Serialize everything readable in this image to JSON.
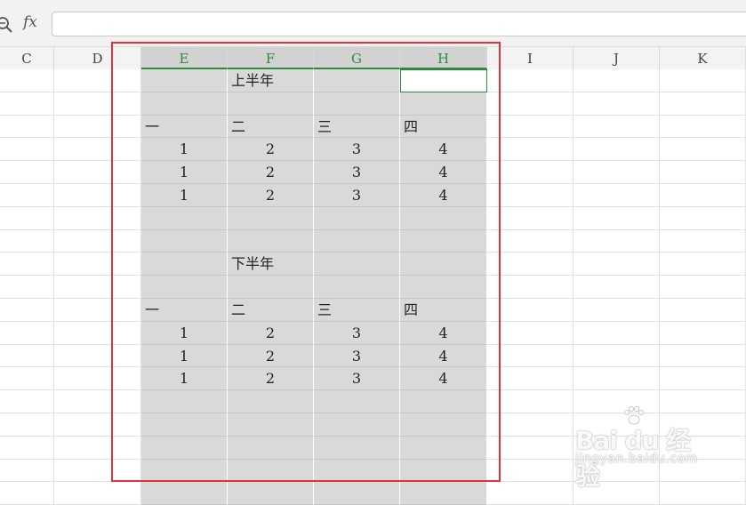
{
  "formula_bar": {
    "fx_label": "fx",
    "input_value": ""
  },
  "columns": [
    {
      "key": "C",
      "label": "C",
      "selected": false
    },
    {
      "key": "D",
      "label": "D",
      "selected": false
    },
    {
      "key": "E",
      "label": "E",
      "selected": true
    },
    {
      "key": "F",
      "label": "F",
      "selected": true
    },
    {
      "key": "G",
      "label": "G",
      "selected": true
    },
    {
      "key": "H",
      "label": "H",
      "selected": true
    },
    {
      "key": "I",
      "label": "I",
      "selected": false
    },
    {
      "key": "J",
      "label": "J",
      "selected": false
    },
    {
      "key": "K",
      "label": "K",
      "selected": false
    }
  ],
  "rows": [
    {
      "E": "",
      "F": "上半年",
      "G": "",
      "H": ""
    },
    {
      "E": "",
      "F": "",
      "G": "",
      "H": ""
    },
    {
      "E": "一",
      "F": "二",
      "G": "三",
      "H": "四"
    },
    {
      "E": "1",
      "F": "2",
      "G": "3",
      "H": "4"
    },
    {
      "E": "1",
      "F": "2",
      "G": "3",
      "H": "4"
    },
    {
      "E": "1",
      "F": "2",
      "G": "3",
      "H": "4"
    },
    {
      "E": "",
      "F": "",
      "G": "",
      "H": ""
    },
    {
      "E": "",
      "F": "",
      "G": "",
      "H": ""
    },
    {
      "E": "",
      "F": "下半年",
      "G": "",
      "H": ""
    },
    {
      "E": "",
      "F": "",
      "G": "",
      "H": ""
    },
    {
      "E": "一",
      "F": "二",
      "G": "三",
      "H": "四"
    },
    {
      "E": "1",
      "F": "2",
      "G": "3",
      "H": "4"
    },
    {
      "E": "1",
      "F": "2",
      "G": "3",
      "H": "4"
    },
    {
      "E": "1",
      "F": "2",
      "G": "3",
      "H": "4"
    },
    {
      "E": "",
      "F": "",
      "G": "",
      "H": ""
    },
    {
      "E": "",
      "F": "",
      "G": "",
      "H": ""
    },
    {
      "E": "",
      "F": "",
      "G": "",
      "H": ""
    },
    {
      "E": "",
      "F": "",
      "G": "",
      "H": ""
    },
    {
      "E": "",
      "F": "",
      "G": "",
      "H": ""
    }
  ],
  "active_cell": {
    "row": 0,
    "col": "H"
  },
  "selected_columns": [
    "E",
    "F",
    "G",
    "H"
  ],
  "colors": {
    "selection_fill": "#d9d9d9",
    "header_selected": "#d2d2d2",
    "accent_green": "#2f8b3d",
    "highlight_red": "#e2323a"
  },
  "icons": {
    "formula_zoom": "zoom-icon",
    "watermark_logo": "paw-icon"
  },
  "watermark": {
    "main": "Bai du 经验",
    "sub": "jingyan.baidu.com"
  }
}
